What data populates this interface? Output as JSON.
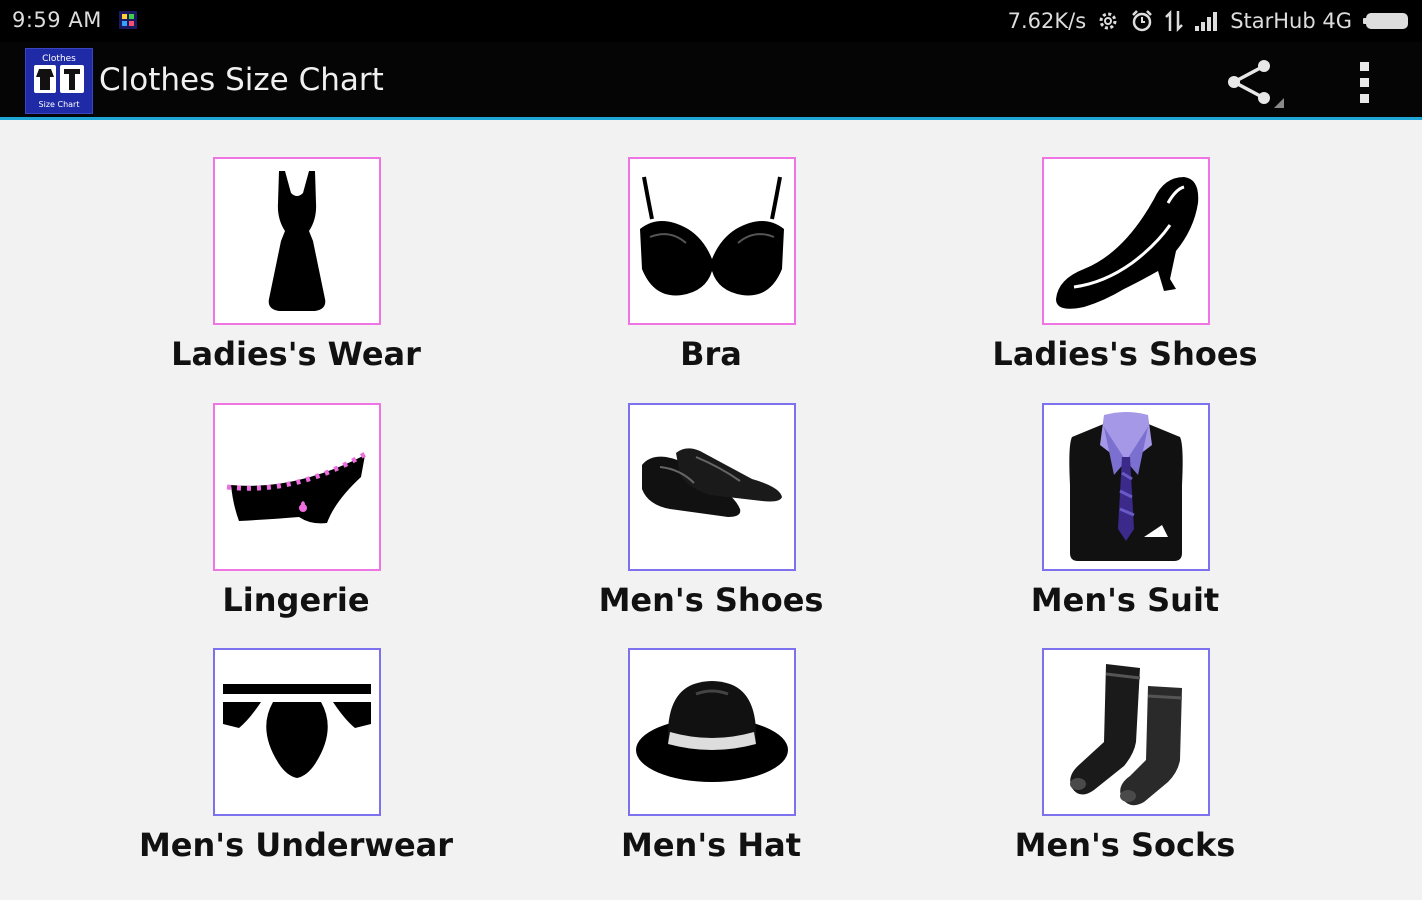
{
  "status_bar": {
    "time": "9:59 AM",
    "net_speed": "7.62K/s",
    "carrier": "StarHub 4G"
  },
  "action_bar": {
    "title": "Clothes Size Chart",
    "app_icon_top_text": "Clothes",
    "app_icon_bottom_text": "Size Chart",
    "accent": "#1fa6d6"
  },
  "categories": [
    {
      "label": "Ladies's Wear",
      "icon": "dress-icon",
      "group": "ladies"
    },
    {
      "label": "Bra",
      "icon": "bra-icon",
      "group": "ladies"
    },
    {
      "label": "Ladies's Shoes",
      "icon": "high-heel-icon",
      "group": "ladies"
    },
    {
      "label": "Lingerie",
      "icon": "lingerie-icon",
      "group": "ladies"
    },
    {
      "label": "Men's Shoes",
      "icon": "mens-shoes-icon",
      "group": "men"
    },
    {
      "label": "Men's Suit",
      "icon": "suit-icon",
      "group": "men"
    },
    {
      "label": "Men's Underwear",
      "icon": "underwear-icon",
      "group": "men"
    },
    {
      "label": "Men's Hat",
      "icon": "hat-icon",
      "group": "men"
    },
    {
      "label": "Men's Socks",
      "icon": "socks-icon",
      "group": "men"
    }
  ],
  "colors": {
    "ladies_border": "#ef74e4",
    "men_border": "#7d71ee"
  }
}
